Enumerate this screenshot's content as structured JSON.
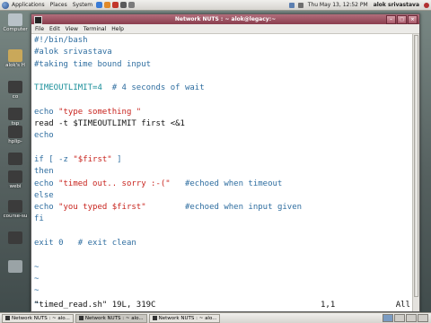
{
  "top_panel": {
    "menus": [
      "Applications",
      "Places",
      "System"
    ],
    "datetime": "Thu May 13, 12:52 PM",
    "user": "alok srivastava"
  },
  "desktop_icons": [
    {
      "label": "Computer",
      "icon": "computer-icon"
    },
    {
      "label": "alok's H",
      "icon": "home-folder-icon"
    },
    {
      "label": "co",
      "icon": "folder-icon"
    },
    {
      "label": "tsp",
      "icon": "folder-icon"
    },
    {
      "label": "hplip-",
      "icon": "folder-icon"
    },
    {
      "label": "",
      "icon": "folder-icon"
    },
    {
      "label": "webi",
      "icon": "folder-icon"
    },
    {
      "label": "course-su",
      "icon": "folder-icon"
    },
    {
      "label": "",
      "icon": "folder-icon"
    },
    {
      "label": "",
      "icon": "trash-icon"
    }
  ],
  "window": {
    "title": "Network NUTS : ~ alok@legacy:~",
    "menu": [
      "File",
      "Edit",
      "View",
      "Terminal",
      "Help"
    ]
  },
  "editor": {
    "lines": [
      [
        {
          "t": "#!/bin/bash",
          "c": "com"
        }
      ],
      [
        {
          "t": "#alok srivastava",
          "c": "com"
        }
      ],
      [
        {
          "t": "#taking time bound input",
          "c": "com"
        }
      ],
      [],
      [
        {
          "t": "TIMEOUTLIMIT=4",
          "c": "var"
        },
        {
          "t": "  # 4 seconds of wait",
          "c": "com"
        }
      ],
      [],
      [
        {
          "t": "echo ",
          "c": "kw"
        },
        {
          "t": "\"type something \"",
          "c": "str"
        }
      ],
      [
        {
          "t": "read -t $TIMEOUTLIMIT first <&1",
          "c": "plain"
        }
      ],
      [
        {
          "t": "echo",
          "c": "kw"
        }
      ],
      [],
      [
        {
          "t": "if [ -z ",
          "c": "kw"
        },
        {
          "t": "\"$first\"",
          "c": "str"
        },
        {
          "t": " ]",
          "c": "kw"
        }
      ],
      [
        {
          "t": "then",
          "c": "kw"
        }
      ],
      [
        {
          "t": "echo ",
          "c": "kw"
        },
        {
          "t": "\"timed out.. sorry :-(\"",
          "c": "str"
        },
        {
          "t": "   #echoed when timeout",
          "c": "com"
        }
      ],
      [
        {
          "t": "else",
          "c": "kw"
        }
      ],
      [
        {
          "t": "echo ",
          "c": "kw"
        },
        {
          "t": "\"you typed $first\"",
          "c": "str"
        },
        {
          "t": "        #echoed when input given",
          "c": "com"
        }
      ],
      [
        {
          "t": "fi",
          "c": "kw"
        }
      ],
      [],
      [
        {
          "t": "exit 0",
          "c": "kw"
        },
        {
          "t": "   # exit clean",
          "c": "com"
        }
      ],
      [],
      [
        {
          "t": "~",
          "c": "tilde"
        }
      ],
      [
        {
          "t": "~",
          "c": "tilde"
        }
      ],
      [
        {
          "t": "~",
          "c": "tilde"
        }
      ],
      [
        {
          "t": "~",
          "c": "tilde"
        }
      ]
    ],
    "status": {
      "file_info": "\"timed_read.sh\" 19L, 319C",
      "position": "1,1",
      "percent": "All"
    }
  },
  "taskbar": {
    "tasks": [
      {
        "label": "Network NUTS : ~ alo...",
        "active": false
      },
      {
        "label": "Network NUTS : ~ alo...",
        "active": true
      },
      {
        "label": "Network NUTS : ~ alo...",
        "active": false
      }
    ]
  }
}
